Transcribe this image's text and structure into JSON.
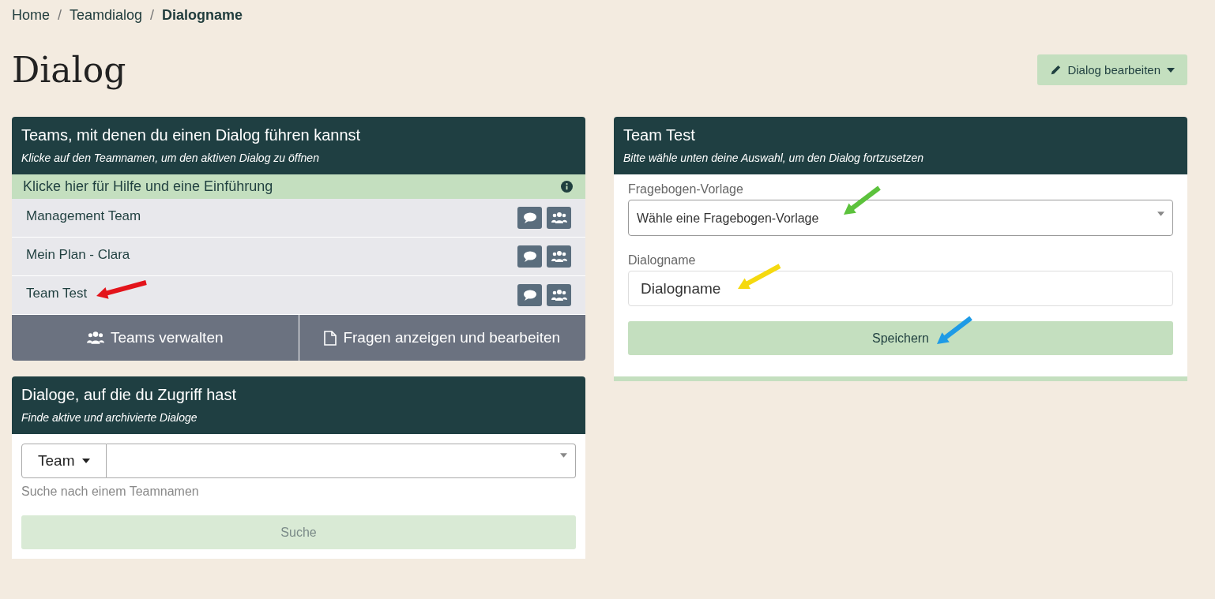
{
  "breadcrumb": [
    {
      "label": "Home",
      "current": false
    },
    {
      "label": "Teamdialog",
      "current": false
    },
    {
      "label": "Dialogname",
      "current": true
    }
  ],
  "breadcrumb_separator": "/",
  "page_title": "Dialog",
  "edit_button": {
    "label": "Dialog bearbeiten"
  },
  "teams_card": {
    "title": "Teams, mit denen du einen Dialog führen kannst",
    "subtitle": "Klicke auf den Teamnamen, um den aktiven Dialog zu öffnen",
    "help": "Klicke hier für Hilfe und eine Einführung",
    "teams": [
      {
        "name": "Management Team"
      },
      {
        "name": "Mein Plan - Clara"
      },
      {
        "name": "Team Test"
      }
    ],
    "actions": [
      {
        "kind": "teams",
        "label": "Teams verwalten"
      },
      {
        "kind": "questions",
        "label": "Fragen anzeigen und bearbeiten"
      }
    ]
  },
  "dialogs_card": {
    "title": "Dialoge, auf die du Zugriff hast",
    "subtitle": "Finde aktive und archivierte Dialoge",
    "filter": "Team",
    "help_text": "Suche nach einem Teamnamen",
    "search_button": {
      "label": "Suche",
      "disabled": true
    }
  },
  "form_card": {
    "title": "Team Test",
    "subtitle": "Bitte wähle unten deine Auswahl, um den Dialog fortzusetzen",
    "template_label": "Fragebogen-Vorlage",
    "template_value": "Wähle eine Fragebogen-Vorlage",
    "name_label": "Dialogname",
    "name_value": "Dialogname",
    "save_button": "Speichern"
  },
  "annotation_arrows": [
    {
      "color": "#e3141b"
    },
    {
      "color": "#5cc23c"
    },
    {
      "color": "#f5d90f"
    },
    {
      "color": "#1e9be6"
    }
  ]
}
